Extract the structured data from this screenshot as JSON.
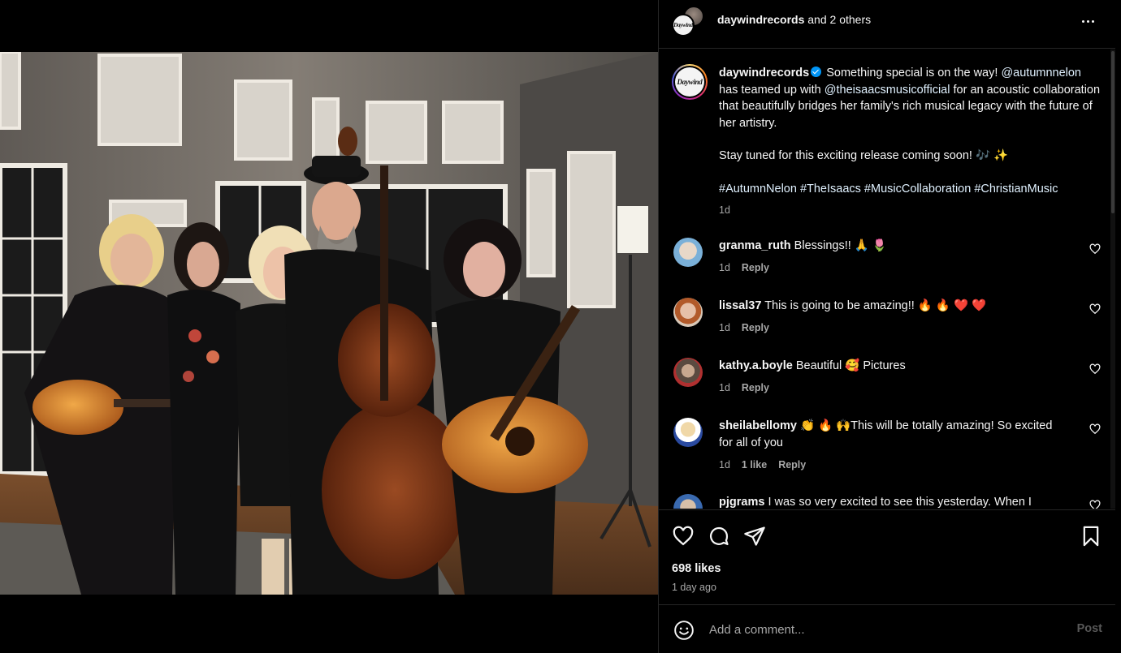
{
  "header": {
    "username": "daywindrecords",
    "others": "and 2 others",
    "logo_text": "Daywind"
  },
  "caption": {
    "username": "daywindrecords",
    "line1_start": "Something special is on the way!",
    "mention1": "@autumnnelon",
    "mid1": "has teamed up with",
    "mention2": "@theisaacsmusicofficial",
    "line1_end": "for an acoustic collaboration that beautifully bridges her family's rich musical legacy with the future of her artistry.",
    "para2": "Stay tuned for this exciting release coming soon! 🎶 ✨",
    "hashtags": "#AutumnNelon #TheIsaacs #MusicCollaboration #ChristianMusic",
    "time": "1d"
  },
  "comments": [
    {
      "username": "granma_ruth",
      "text": "Blessings!! 🙏 🌷",
      "time": "1d",
      "likes": "",
      "reply": "Reply"
    },
    {
      "username": "lissal37",
      "text": "This is going to be amazing!! 🔥 🔥 ❤️ ❤️",
      "time": "1d",
      "likes": "",
      "reply": "Reply"
    },
    {
      "username": "kathy.a.boyle",
      "text": "Beautiful 🥰 Pictures",
      "time": "1d",
      "likes": "",
      "reply": "Reply"
    },
    {
      "username": "sheilabellomy",
      "text": "👏 🔥 🙌This will be totally amazing! So excited for all of you",
      "time": "1d",
      "likes": "1 like",
      "reply": "Reply"
    },
    {
      "username": "pjgrams",
      "text": "I was so very excited to see this yesterday. When I",
      "time": "",
      "likes": "",
      "reply": ""
    }
  ],
  "actions": {
    "likes": "698 likes",
    "time": "1 day ago"
  },
  "add_comment": {
    "placeholder": "Add a comment...",
    "post_label": "Post"
  },
  "icons": {
    "more": "more-horizontal-icon",
    "like": "heart-icon",
    "comment": "comment-icon",
    "share": "send-icon",
    "save": "bookmark-icon",
    "emoji": "emoji-icon"
  },
  "colors": {
    "background": "#000000",
    "secondary_text": "#a8a8a8",
    "verified": "#0095f6",
    "link": "#e0f1ff",
    "post_disabled": "#585858"
  }
}
